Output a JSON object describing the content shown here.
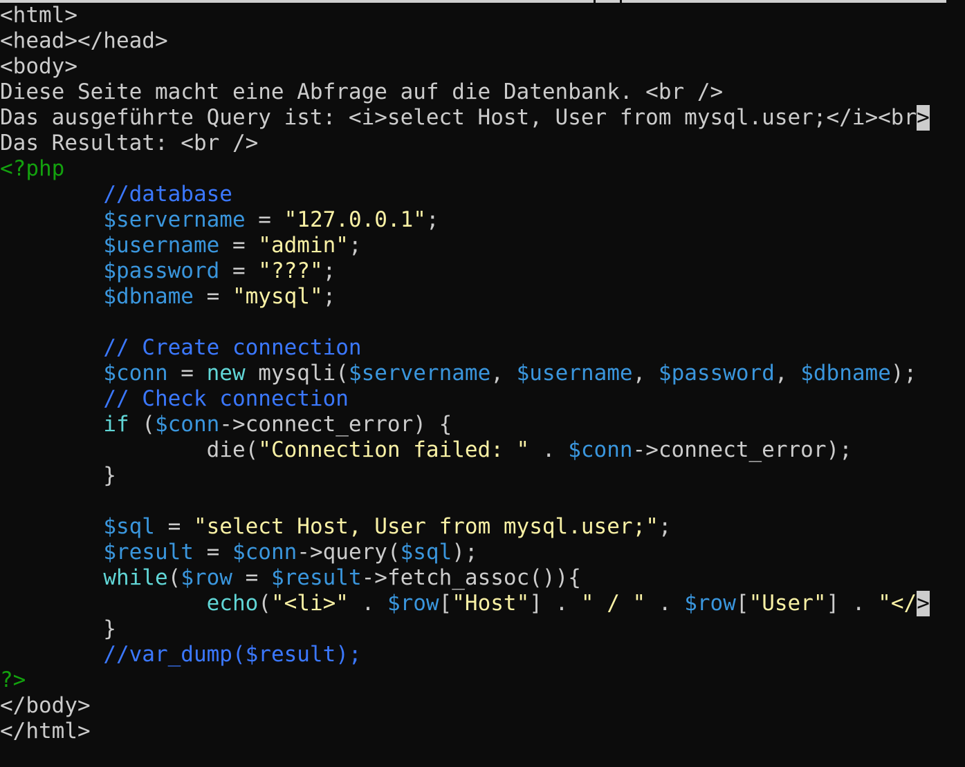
{
  "window": {
    "title": "",
    "colors": {
      "background": "#0c0c0c",
      "text": "#cccccc",
      "php_delimiter": "#13a10e",
      "comment": "#3b78ff",
      "variable": "#3a96dd",
      "string": "#f9f1a5",
      "keyword": "#61d6d6"
    }
  },
  "editor": {
    "lines": [
      [
        {
          "t": "<html>",
          "c": "tag"
        }
      ],
      [
        {
          "t": "<head></head>",
          "c": "tag"
        }
      ],
      [
        {
          "t": "<body>",
          "c": "tag"
        }
      ],
      [
        {
          "t": "Diese Seite macht eine Abfrage auf die Datenbank. <br />",
          "c": "text"
        }
      ],
      [
        {
          "t": "Das ausgeführte Query ist: <i>select Host, User from mysql.user;</i><br",
          "c": "text"
        },
        {
          "t": ">",
          "c": "cursor"
        }
      ],
      [
        {
          "t": "Das Resultat: <br />",
          "c": "text"
        }
      ],
      [
        {
          "t": "<?php",
          "c": "php"
        }
      ],
      [
        {
          "t": "        ",
          "c": "text"
        },
        {
          "t": "//database",
          "c": "comment"
        }
      ],
      [
        {
          "t": "        ",
          "c": "text"
        },
        {
          "t": "$servername",
          "c": "var"
        },
        {
          "t": " = ",
          "c": "text"
        },
        {
          "t": "\"127.0.0.1\"",
          "c": "string"
        },
        {
          "t": ";",
          "c": "text"
        }
      ],
      [
        {
          "t": "        ",
          "c": "text"
        },
        {
          "t": "$username",
          "c": "var"
        },
        {
          "t": " = ",
          "c": "text"
        },
        {
          "t": "\"admin\"",
          "c": "string"
        },
        {
          "t": ";",
          "c": "text"
        }
      ],
      [
        {
          "t": "        ",
          "c": "text"
        },
        {
          "t": "$password",
          "c": "var"
        },
        {
          "t": " = ",
          "c": "text"
        },
        {
          "t": "\"???\"",
          "c": "string"
        },
        {
          "t": ";",
          "c": "text"
        }
      ],
      [
        {
          "t": "        ",
          "c": "text"
        },
        {
          "t": "$dbname",
          "c": "var"
        },
        {
          "t": " = ",
          "c": "text"
        },
        {
          "t": "\"mysql\"",
          "c": "string"
        },
        {
          "t": ";",
          "c": "text"
        }
      ],
      [
        {
          "t": "",
          "c": "text"
        }
      ],
      [
        {
          "t": "        ",
          "c": "text"
        },
        {
          "t": "// Create connection",
          "c": "comment"
        }
      ],
      [
        {
          "t": "        ",
          "c": "text"
        },
        {
          "t": "$conn",
          "c": "var"
        },
        {
          "t": " = ",
          "c": "text"
        },
        {
          "t": "new",
          "c": "keyword"
        },
        {
          "t": " mysqli(",
          "c": "text"
        },
        {
          "t": "$servername",
          "c": "var"
        },
        {
          "t": ", ",
          "c": "text"
        },
        {
          "t": "$username",
          "c": "var"
        },
        {
          "t": ", ",
          "c": "text"
        },
        {
          "t": "$password",
          "c": "var"
        },
        {
          "t": ", ",
          "c": "text"
        },
        {
          "t": "$dbname",
          "c": "var"
        },
        {
          "t": ");",
          "c": "text"
        }
      ],
      [
        {
          "t": "        ",
          "c": "text"
        },
        {
          "t": "// Check connection",
          "c": "comment"
        }
      ],
      [
        {
          "t": "        ",
          "c": "text"
        },
        {
          "t": "if",
          "c": "keyword"
        },
        {
          "t": " (",
          "c": "text"
        },
        {
          "t": "$conn",
          "c": "var"
        },
        {
          "t": "->connect_error) {",
          "c": "text"
        }
      ],
      [
        {
          "t": "                die(",
          "c": "text"
        },
        {
          "t": "\"Connection failed: \"",
          "c": "string"
        },
        {
          "t": " . ",
          "c": "text"
        },
        {
          "t": "$conn",
          "c": "var"
        },
        {
          "t": "->connect_error);",
          "c": "text"
        }
      ],
      [
        {
          "t": "        }",
          "c": "text"
        }
      ],
      [
        {
          "t": "",
          "c": "text"
        }
      ],
      [
        {
          "t": "        ",
          "c": "text"
        },
        {
          "t": "$sql",
          "c": "var"
        },
        {
          "t": " = ",
          "c": "text"
        },
        {
          "t": "\"select Host, User from mysql.user;\"",
          "c": "string"
        },
        {
          "t": ";",
          "c": "text"
        }
      ],
      [
        {
          "t": "        ",
          "c": "text"
        },
        {
          "t": "$result",
          "c": "var"
        },
        {
          "t": " = ",
          "c": "text"
        },
        {
          "t": "$conn",
          "c": "var"
        },
        {
          "t": "->query(",
          "c": "text"
        },
        {
          "t": "$sql",
          "c": "var"
        },
        {
          "t": ");",
          "c": "text"
        }
      ],
      [
        {
          "t": "        ",
          "c": "text"
        },
        {
          "t": "while",
          "c": "keyword"
        },
        {
          "t": "(",
          "c": "text"
        },
        {
          "t": "$row",
          "c": "var"
        },
        {
          "t": " = ",
          "c": "text"
        },
        {
          "t": "$result",
          "c": "var"
        },
        {
          "t": "->fetch_assoc()){",
          "c": "text"
        }
      ],
      [
        {
          "t": "                ",
          "c": "text"
        },
        {
          "t": "echo",
          "c": "keyword"
        },
        {
          "t": "(",
          "c": "text"
        },
        {
          "t": "\"<li>\"",
          "c": "string"
        },
        {
          "t": " . ",
          "c": "text"
        },
        {
          "t": "$row",
          "c": "var"
        },
        {
          "t": "[",
          "c": "text"
        },
        {
          "t": "\"Host\"",
          "c": "string"
        },
        {
          "t": "] . ",
          "c": "text"
        },
        {
          "t": "\" / \"",
          "c": "string"
        },
        {
          "t": " . ",
          "c": "text"
        },
        {
          "t": "$row",
          "c": "var"
        },
        {
          "t": "[",
          "c": "text"
        },
        {
          "t": "\"User\"",
          "c": "string"
        },
        {
          "t": "] . ",
          "c": "text"
        },
        {
          "t": "\"</",
          "c": "string"
        },
        {
          "t": ">",
          "c": "cursor"
        }
      ],
      [
        {
          "t": "        }",
          "c": "text"
        }
      ],
      [
        {
          "t": "        ",
          "c": "text"
        },
        {
          "t": "//var_dump($result);",
          "c": "comment"
        }
      ],
      [
        {
          "t": "?>",
          "c": "php"
        }
      ],
      [
        {
          "t": "</body>",
          "c": "tag"
        }
      ],
      [
        {
          "t": "</html>",
          "c": "tag"
        }
      ]
    ]
  }
}
